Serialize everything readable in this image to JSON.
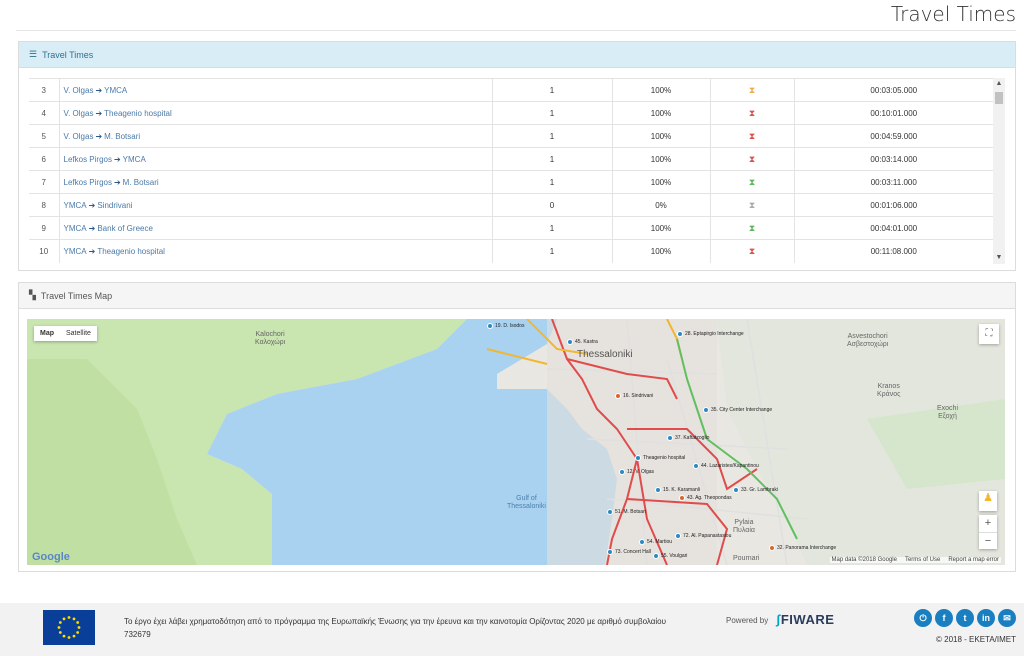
{
  "page": {
    "title": "Travel Times"
  },
  "travel_panel": {
    "heading": "Travel Times"
  },
  "table": {
    "rows": [
      {
        "num": "3",
        "from": "V. Olgas",
        "to": "YMCA",
        "count": "1",
        "pct": "100%",
        "status": "amber",
        "time": "00:03:05.000"
      },
      {
        "num": "4",
        "from": "V. Olgas",
        "to": "Theagenio hospital",
        "count": "1",
        "pct": "100%",
        "status": "red",
        "time": "00:10:01.000"
      },
      {
        "num": "5",
        "from": "V. Olgas",
        "to": "M. Botsari",
        "count": "1",
        "pct": "100%",
        "status": "red",
        "time": "00:04:59.000"
      },
      {
        "num": "6",
        "from": "Lefkos Pirgos",
        "to": "YMCA",
        "count": "1",
        "pct": "100%",
        "status": "red",
        "time": "00:03:14.000"
      },
      {
        "num": "7",
        "from": "Lefkos Pirgos",
        "to": "M. Botsari",
        "count": "1",
        "pct": "100%",
        "status": "green",
        "time": "00:03:11.000"
      },
      {
        "num": "8",
        "from": "YMCA",
        "to": "Sindrivani",
        "count": "0",
        "pct": "0%",
        "status": "grey",
        "time": "00:01:06.000"
      },
      {
        "num": "9",
        "from": "YMCA",
        "to": "Bank of Greece",
        "count": "1",
        "pct": "100%",
        "status": "green",
        "time": "00:04:01.000"
      },
      {
        "num": "10",
        "from": "YMCA",
        "to": "Theagenio hospital",
        "count": "1",
        "pct": "100%",
        "status": "red",
        "time": "00:11:08.000"
      }
    ],
    "status_colors": {
      "amber": "#f0ad4e",
      "red": "#d9534f",
      "green": "#5cb85c",
      "grey": "#aaaaaa"
    }
  },
  "map_panel": {
    "heading": "Travel Times Map",
    "map_button": "Map",
    "satellite_button": "Satellite",
    "google": "Google",
    "map_data": "Map data ©2018 Google",
    "terms": "Terms of Use",
    "report": "Report a map error",
    "labels": {
      "kalochori": "Kalochori\nΚαλοχώρι",
      "asvestochori": "Asvestochori\nΑσβεστοχώρι",
      "kranos": "Kranos\nΚράνος",
      "exochi": "Exochi\nΕξοχή",
      "pylaia": "Pylaia\nΠυλαία",
      "pournari": "Pournari",
      "thessaloniki": "Thessaloniki",
      "gulf": "Gulf of\nThessaloniki"
    },
    "pois": [
      {
        "label": "19. D. Isodos",
        "color": "#2b8ac6"
      },
      {
        "label": "28. Eptapirgio Interchange",
        "color": "#2b8ac6"
      },
      {
        "label": "45. Kastra",
        "color": "#2b8ac6"
      },
      {
        "label": "16. Sindrivani",
        "color": "#d9672c"
      },
      {
        "label": "35. City Center Interchange",
        "color": "#2b8ac6"
      },
      {
        "label": "37. Kaftatzoglio",
        "color": "#2b8ac6"
      },
      {
        "label": "Theagenio hospital",
        "color": "#2b8ac6"
      },
      {
        "label": "12. V. Olgas",
        "color": "#2b8ac6"
      },
      {
        "label": "44. Lazaristes/Kapantinou",
        "color": "#2b8ac6"
      },
      {
        "label": "15. K. Karamanli",
        "color": "#2b8ac6"
      },
      {
        "label": "43. Ag. Theopondas",
        "color": "#d9672c"
      },
      {
        "label": "33. Gr. Lambraki",
        "color": "#2b8ac6"
      },
      {
        "label": "51. M. Botsari",
        "color": "#2b8ac6"
      },
      {
        "label": "72. Al. Papanastasiou",
        "color": "#2b8ac6"
      },
      {
        "label": "54. Martiou",
        "color": "#2b8ac6"
      },
      {
        "label": "32. Panorama Interchange",
        "color": "#d9672c"
      },
      {
        "label": "73. Concert Hall",
        "color": "#2b8ac6"
      },
      {
        "label": "55. Voulgari",
        "color": "#2b8ac6"
      }
    ]
  },
  "footer": {
    "text": "Το έργο έχει λάβει χρηματοδότηση από το πρόγραμμα της Ευρωπαϊκής Ένωσης για την έρευνα και την καινοτομία Ορίζοντας 2020 με αριθμό συμβολαίου 732679",
    "powered_by": "Powered by",
    "fiware": "FIWARE",
    "copyright": "© 2018 - EKETA/IMET"
  }
}
